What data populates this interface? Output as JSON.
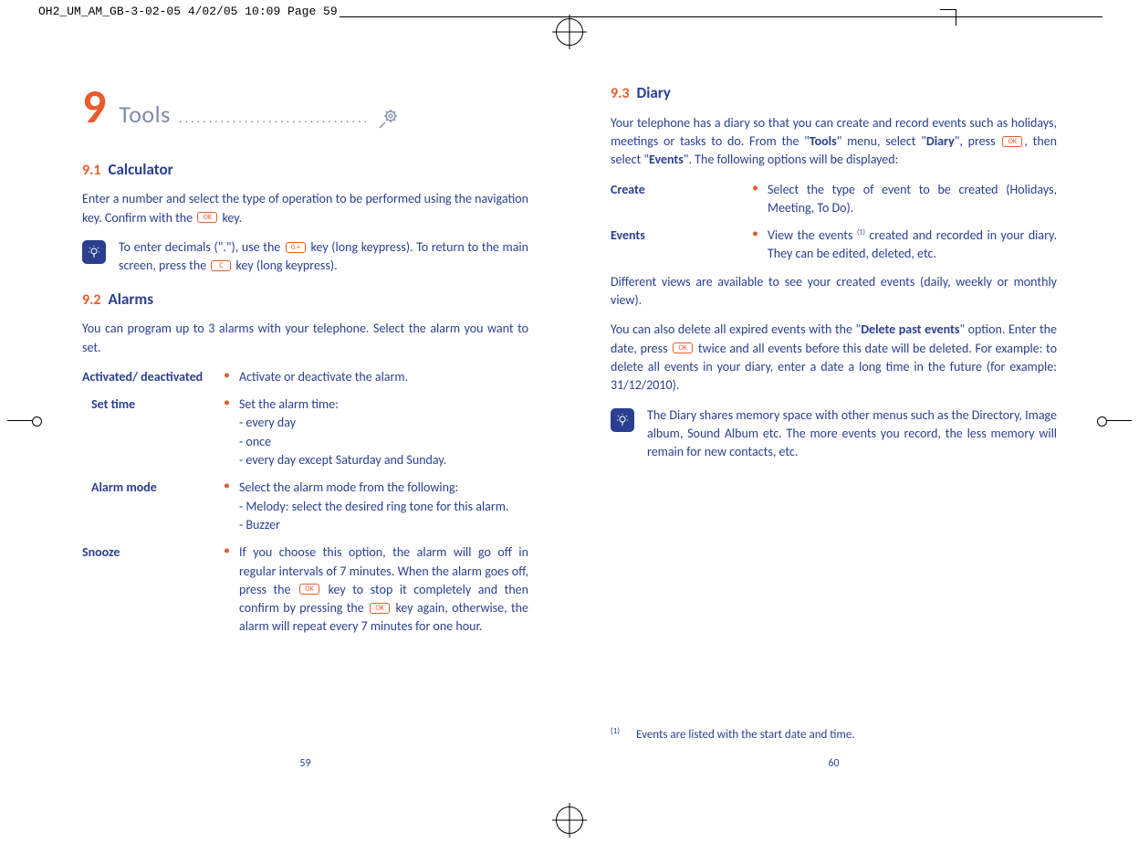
{
  "header": {
    "file_stamp": "OH2_UM_AM_GB-3-02-05   4/02/05  10:09  Page 59"
  },
  "left": {
    "chapter_num": "9",
    "chapter_title": "Tools",
    "dots": "................................",
    "sec91_num": "9.1",
    "sec91_title": "Calculator",
    "p91": "Enter a number and select the type of operation to be performed using the navigation key. Confirm with the ",
    "p91_tail": " key.",
    "tip91a": "To enter decimals (\".\"), use the ",
    "tip91b": " key (long keypress). To return to the main screen, press the ",
    "tip91c": " key (long keypress).",
    "sec92_num": "9.2",
    "sec92_title": "Alarms",
    "p92": "You can program up to 3 alarms with your telephone. Select the alarm you want to set.",
    "items": {
      "activated_term": "Activated/ deactivated",
      "activated_desc": "Activate or deactivate the alarm.",
      "settime_term": "Set time",
      "settime_desc": "Set the alarm time:\n- every day\n- once\n- every day except Saturday and Sunday.",
      "alarmmode_term": "Alarm mode",
      "alarmmode_desc": "Select the alarm mode from the following:\n- Melody: select the desired ring tone for this alarm.\n- Buzzer",
      "snooze_term": "Snooze",
      "snooze_a": "If you choose this option, the alarm will go off in regular intervals of 7 minutes. When the alarm goes off, press the ",
      "snooze_b": " key to stop it completely and then confirm by pressing the ",
      "snooze_c": " key again, otherwise, the alarm will repeat every 7 minutes for one hour."
    },
    "page_num": "59"
  },
  "right": {
    "sec93_num": "9.3",
    "sec93_title": "Diary",
    "p93a": "Your telephone has a diary so that you can create and record events such as holidays, meetings or tasks to do. From the \"",
    "p93b": "\" menu, select \"",
    "p93c": "\", press ",
    "p93d": ", then select \"",
    "p93e": "\". The following options will be displayed:",
    "w_tools": "Tools",
    "w_diary": "Diary",
    "w_events": "Events",
    "create_term": "Create",
    "create_desc": "Select the type of event to be created (Holidays, Meeting, To Do).",
    "events_term": "Events",
    "events_desc_a": "View the events ",
    "events_desc_b": " created and recorded in your diary. They can be edited, deleted, etc.",
    "p93f": "Different views are available to see your created events (daily, weekly or monthly view).",
    "p93g_a": "You can also delete all expired events with the \"",
    "p93g_bold": "Delete past events",
    "p93g_b": "\" option. Enter the date, press ",
    "p93g_c": " twice and all events before this date will be deleted. For example: to delete all events in your diary, enter a date a long time in the future (for example: 31/12/2010).",
    "tip93": "The Diary shares memory space with other menus such as the Directory, Image album, Sound Album etc. The more events you record, the less memory will remain for new contacts, etc.",
    "footnote_mark": "(1)",
    "footnote": "Events are listed with the start date and time.",
    "page_num": "60"
  },
  "keys": {
    "ok": "OK",
    "zero": "0.+",
    "c": "C"
  }
}
